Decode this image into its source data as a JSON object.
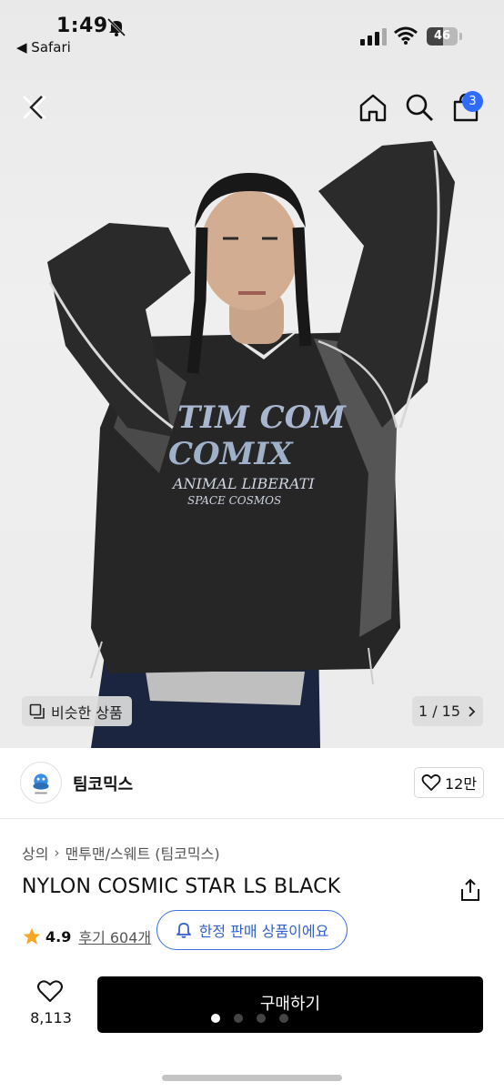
{
  "status_bar": {
    "time": "1:49",
    "back_app": "◀ Safari",
    "battery": "46"
  },
  "nav": {
    "cart_count": "3"
  },
  "image": {
    "similar_label": "비슷한 상품",
    "counter": "1 / 15",
    "current_index": 1,
    "total": 15
  },
  "brand": {
    "name": "팀코믹스",
    "likes": "12만"
  },
  "product": {
    "breadcrumb": [
      "상의",
      "맨투맨/스웨트 (팀코믹스)"
    ],
    "title": "NYLON COSMIC STAR LS BLACK",
    "rating": "4.9",
    "reviews": "후기 604개",
    "limited_text": "한정 판매 상품이에요"
  },
  "bottom": {
    "wish_count": "8,113",
    "buy_label": "구매하기",
    "page_dots": 4,
    "active_dot": 1
  },
  "colors": {
    "accent_blue": "#2f6bff",
    "buy_button": "#000000",
    "star": "#f5a623"
  }
}
